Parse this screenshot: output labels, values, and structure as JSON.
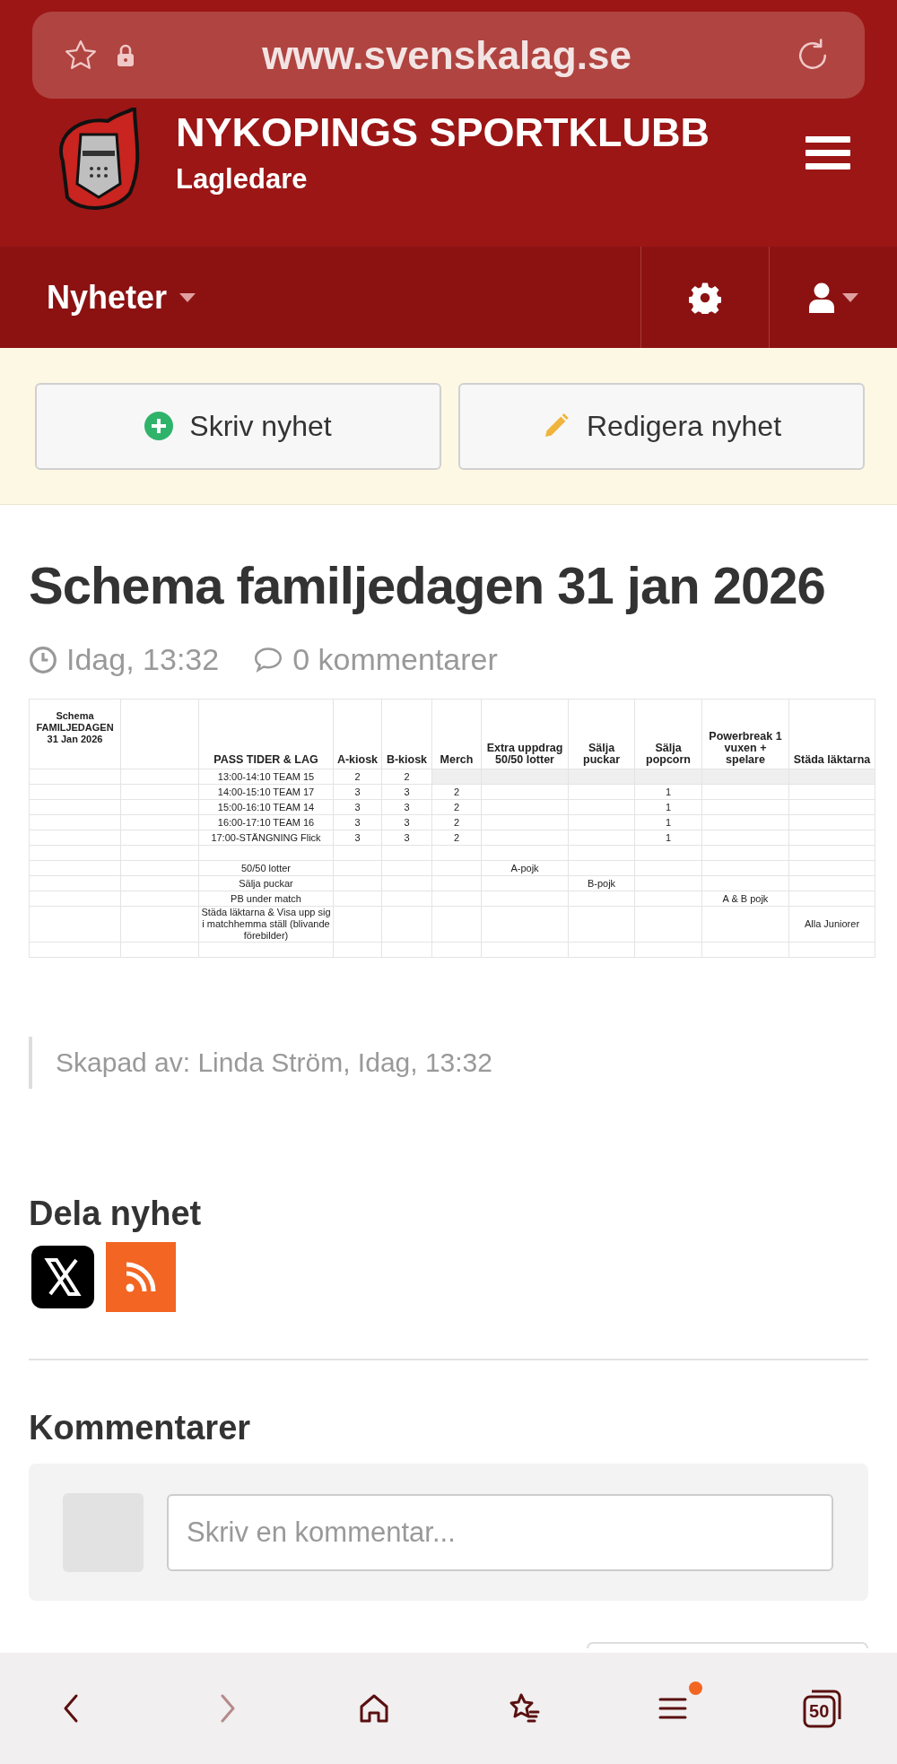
{
  "browser": {
    "url": "www.svenskalag.se"
  },
  "header": {
    "club": "NYKOPINGS SPORTKLUBB",
    "role": "Lagledare"
  },
  "nav": {
    "section": "Nyheter"
  },
  "toolbar": {
    "buttons": [
      {
        "kind": "add",
        "label": "Skriv nyhet"
      },
      {
        "kind": "edit",
        "label": "Redigera nyhet"
      }
    ]
  },
  "article": {
    "title": "Schema familjedagen 31 jan 2026",
    "time": "Idag, 13:32",
    "comments": "0 kommentarer",
    "sheet": {
      "title": "Schema FAMILJEDAGEN 31 Jan 2026",
      "columns": [
        null,
        null,
        "PASS TIDER & LAG",
        "A-kiosk",
        "B-kiosk",
        "Merch",
        "Extra uppdrag 50/50 lotter",
        "Sälja puckar",
        "Sälja popcorn",
        "Powerbreak 1 vuxen + spelare",
        "Städa läktarna"
      ],
      "rows": [
        {
          "shaded_tail": true,
          "cells": [
            null,
            null,
            "13:00-14:10 TEAM 15",
            "2",
            "2",
            null,
            null,
            null,
            null,
            null,
            null
          ]
        },
        {
          "shaded_tail": false,
          "cells": [
            null,
            null,
            "14:00-15:10 TEAM 17",
            "3",
            "3",
            "2",
            null,
            null,
            "1",
            null,
            null
          ]
        },
        {
          "shaded_tail": false,
          "cells": [
            null,
            null,
            "15:00-16:10 TEAM 14",
            "3",
            "3",
            "2",
            null,
            null,
            "1",
            null,
            null
          ]
        },
        {
          "shaded_tail": false,
          "cells": [
            null,
            null,
            "16:00-17:10 TEAM 16",
            "3",
            "3",
            "2",
            null,
            null,
            "1",
            null,
            null
          ]
        },
        {
          "shaded_tail": false,
          "cells": [
            null,
            null,
            "17:00-STÄNGNING Flick",
            "3",
            "3",
            "2",
            null,
            null,
            "1",
            null,
            null
          ]
        },
        {
          "shaded_tail": false,
          "cells": [
            null,
            null,
            null,
            null,
            null,
            null,
            null,
            null,
            null,
            null,
            null
          ]
        },
        {
          "shaded_tail": false,
          "cells": [
            null,
            null,
            "50/50 lotter",
            null,
            null,
            null,
            "A-pojk",
            null,
            null,
            null,
            null
          ]
        },
        {
          "shaded_tail": false,
          "cells": [
            null,
            null,
            "Sälja puckar",
            null,
            null,
            null,
            null,
            "B-pojk",
            null,
            null,
            null
          ]
        },
        {
          "shaded_tail": false,
          "cells": [
            null,
            null,
            "PB under match",
            null,
            null,
            null,
            null,
            null,
            null,
            "A & B pojk",
            null
          ]
        },
        {
          "shaded_tail": false,
          "cells": [
            null,
            null,
            "Städa läktarna & Visa upp sig i matchhemma ställ (blivande förebilder)",
            null,
            null,
            null,
            null,
            null,
            null,
            null,
            "Alla Juniorer"
          ]
        },
        {
          "shaded_tail": false,
          "cells": [
            null,
            null,
            null,
            null,
            null,
            null,
            null,
            null,
            null,
            null,
            null
          ]
        }
      ]
    },
    "created": "Skapad av: Linda Ström, Idag, 13:32"
  },
  "share": {
    "title": "Dela nyhet",
    "links": [
      {
        "kind": "x"
      },
      {
        "kind": "rss"
      }
    ]
  },
  "comments": {
    "title": "Kommentarer",
    "placeholder": "Skriv en kommentar..."
  },
  "bottom_bar": {
    "items": [
      {
        "kind": "back",
        "disabled": false
      },
      {
        "kind": "forward",
        "disabled": true
      },
      {
        "kind": "home",
        "disabled": false
      },
      {
        "kind": "bookmarks",
        "disabled": false
      },
      {
        "kind": "menu",
        "disabled": false,
        "badge": true
      },
      {
        "kind": "tabs",
        "disabled": false,
        "count": "50"
      }
    ]
  }
}
